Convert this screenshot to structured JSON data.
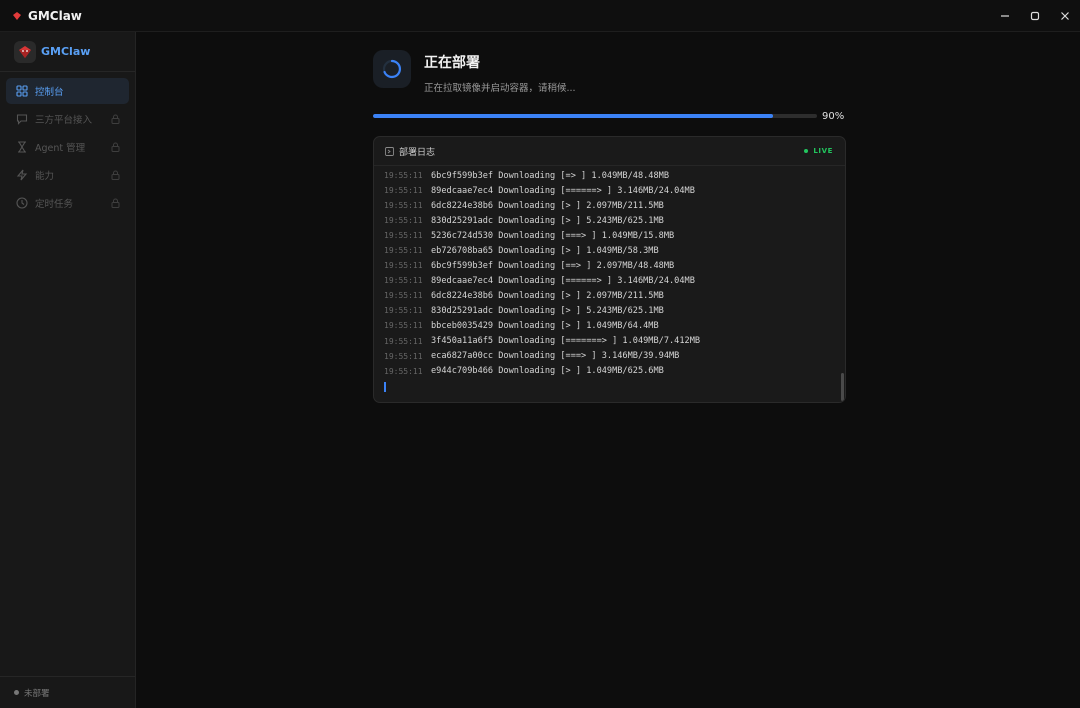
{
  "window": {
    "title": "GMClaw"
  },
  "sidebar": {
    "brand": "GMClaw",
    "items": [
      {
        "label": "控制台",
        "active": true,
        "locked": false,
        "icon": "grid-icon"
      },
      {
        "label": "三方平台接入",
        "active": false,
        "locked": true,
        "icon": "chat-bubble-icon"
      },
      {
        "label": "Agent 管理",
        "active": false,
        "locked": true,
        "icon": "agent-icon"
      },
      {
        "label": "能力",
        "active": false,
        "locked": true,
        "icon": "lightning-icon"
      },
      {
        "label": "定时任务",
        "active": false,
        "locked": true,
        "icon": "clock-icon"
      }
    ],
    "footer_status": "未部署"
  },
  "deploy": {
    "title": "正在部署",
    "subtitle": "正在拉取镜像并启动容器，请稍候...",
    "progress": 0.9,
    "progress_label": "90%"
  },
  "log": {
    "title": "部署日志",
    "live_label": "LIVE",
    "lines": [
      {
        "ts": "19:55:11",
        "msg": "6bc9f599b3ef Downloading [=> ] 1.049MB/48.48MB"
      },
      {
        "ts": "19:55:11",
        "msg": "89edcaae7ec4 Downloading [======> ] 3.146MB/24.04MB"
      },
      {
        "ts": "19:55:11",
        "msg": "6dc8224e38b6 Downloading [> ] 2.097MB/211.5MB"
      },
      {
        "ts": "19:55:11",
        "msg": "830d25291adc Downloading [> ] 5.243MB/625.1MB"
      },
      {
        "ts": "19:55:11",
        "msg": "5236c724d530 Downloading [===> ] 1.049MB/15.8MB"
      },
      {
        "ts": "19:55:11",
        "msg": "eb726708ba65 Downloading [> ] 1.049MB/58.3MB"
      },
      {
        "ts": "19:55:11",
        "msg": "6bc9f599b3ef Downloading [==> ] 2.097MB/48.48MB"
      },
      {
        "ts": "19:55:11",
        "msg": "89edcaae7ec4 Downloading [======> ] 3.146MB/24.04MB"
      },
      {
        "ts": "19:55:11",
        "msg": "6dc8224e38b6 Downloading [> ] 2.097MB/211.5MB"
      },
      {
        "ts": "19:55:11",
        "msg": "830d25291adc Downloading [> ] 5.243MB/625.1MB"
      },
      {
        "ts": "19:55:11",
        "msg": "bbceb0035429 Downloading [> ] 1.049MB/64.4MB"
      },
      {
        "ts": "19:55:11",
        "msg": "3f450a11a6f5 Downloading [=======> ] 1.049MB/7.412MB"
      },
      {
        "ts": "19:55:11",
        "msg": "eca6827a00cc Downloading [===> ] 3.146MB/39.94MB"
      },
      {
        "ts": "19:55:11",
        "msg": "e944c709b466 Downloading [> ] 1.049MB/625.6MB"
      }
    ]
  },
  "colors": {
    "accent": "#3b82f6",
    "live": "#22c55e",
    "brand_red": "#e23b3b"
  }
}
